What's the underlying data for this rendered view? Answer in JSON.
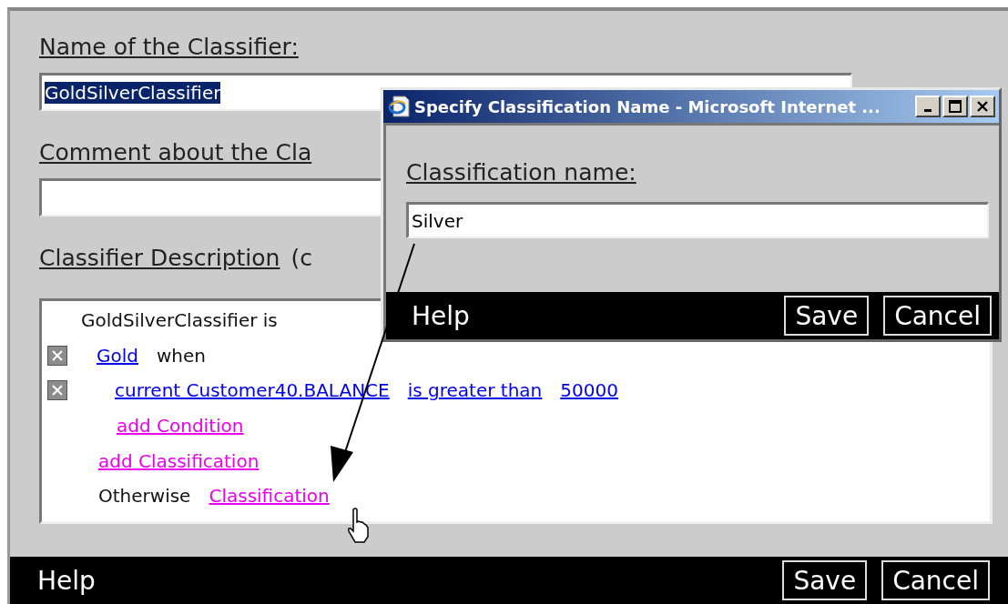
{
  "main": {
    "name_label": "Name of the Classifier:",
    "name_value": "GoldSilverClassifier",
    "name_text_selected": true,
    "comment_label": "Comment about the Cla",
    "description_label": "Classifier Description",
    "description_label_rest": "(c",
    "description": {
      "heading": "GoldSilverClassifier is",
      "classifications": [
        {
          "name": "Gold",
          "connector": "when",
          "conditions": [
            {
              "parts": [
                "current Customer40.BALANCE",
                "is greater than",
                "50000"
              ]
            }
          ],
          "add_condition": "add Condition"
        }
      ],
      "add_classification": "add Classification",
      "otherwise": {
        "label": "Otherwise",
        "link": "Classification"
      }
    },
    "footer": {
      "help": "Help",
      "buttons": [
        "Save",
        "Cancel"
      ]
    }
  },
  "popup": {
    "title": "Specify Classification Name - Microsoft Internet ...",
    "label": "Classification name:",
    "value": "Silver",
    "footer": {
      "help": "Help",
      "buttons": [
        "Save",
        "Cancel"
      ]
    }
  }
}
